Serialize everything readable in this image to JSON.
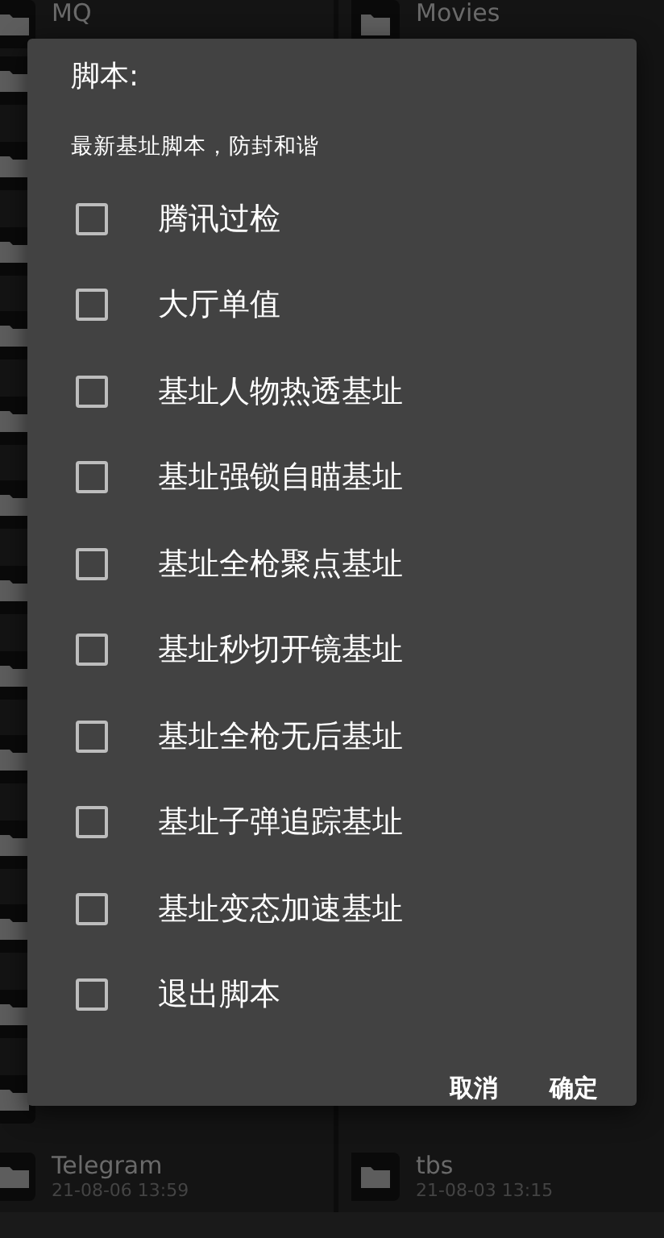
{
  "background": {
    "left": [
      {
        "name": "MQ"
      },
      {
        "name": "Telegram",
        "date": "21-08-06 13:59"
      }
    ],
    "right": [
      {
        "name": "Movies"
      },
      {
        "name": "tbs",
        "date": "21-08-03 13:15"
      }
    ]
  },
  "dialog": {
    "title": "脚本:",
    "message": "最新基址脚本，防封和谐",
    "options": [
      {
        "label": "腾讯过检",
        "checked": false
      },
      {
        "label": "大厅单值",
        "checked": false
      },
      {
        "label": "基址人物热透基址",
        "checked": false
      },
      {
        "label": "基址强锁自瞄基址",
        "checked": false
      },
      {
        "label": "基址全枪聚点基址",
        "checked": false
      },
      {
        "label": "基址秒切开镜基址",
        "checked": false
      },
      {
        "label": "基址全枪无后基址",
        "checked": false
      },
      {
        "label": "基址子弹追踪基址",
        "checked": false
      },
      {
        "label": "基址变态加速基址",
        "checked": false
      },
      {
        "label": "退出脚本",
        "checked": false
      }
    ],
    "buttons": [
      "取消",
      "确定"
    ]
  }
}
